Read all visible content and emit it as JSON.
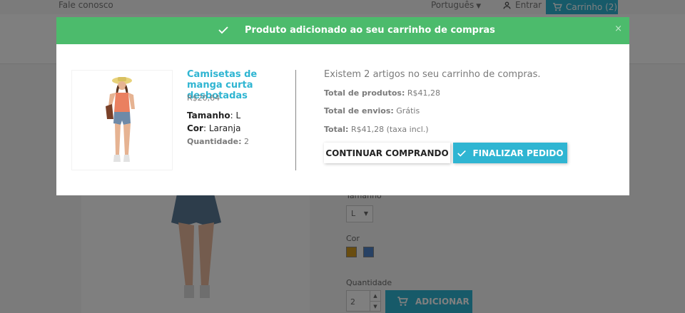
{
  "topbar": {
    "contact": "Fale conosco",
    "language": "Português",
    "sign_in": "Entrar",
    "cart": "Carrinho (2)"
  },
  "product_page": {
    "size_label": "Tamanho",
    "size_value": "L",
    "color_label": "Cor",
    "colors": [
      "#d39b21",
      "#4f82c9"
    ],
    "quantity_label": "Quantidade",
    "quantity_value": "2",
    "add_label": "ADICIONAR"
  },
  "modal": {
    "header_title": "Produto adicionado ao seu carrinho de compras",
    "header_color": "#4cbb6c",
    "close": "×",
    "product": {
      "name": "Camisetas de manga curta desbotadas",
      "price": "R$20,64",
      "size_label": "Tamanho",
      "size_value": "L",
      "color_label": "Cor",
      "color_value": "Laranja",
      "quantity_label": "Quantidade:",
      "quantity_value": "2"
    },
    "cart": {
      "count_text": "Existem 2 artigos no seu carrinho de compras.",
      "total_products_label": "Total de produtos:",
      "total_products_value": "R$41,28",
      "shipping_label": "Total de envios:",
      "shipping_value": "Grátis",
      "total_label": "Total:",
      "total_value": "R$41,28 (taxa incl.)"
    },
    "continue_button": "CONTINUAR COMPRANDO",
    "checkout_button": "FINALIZAR PEDIDO",
    "accent_color": "#2fb5d2"
  }
}
